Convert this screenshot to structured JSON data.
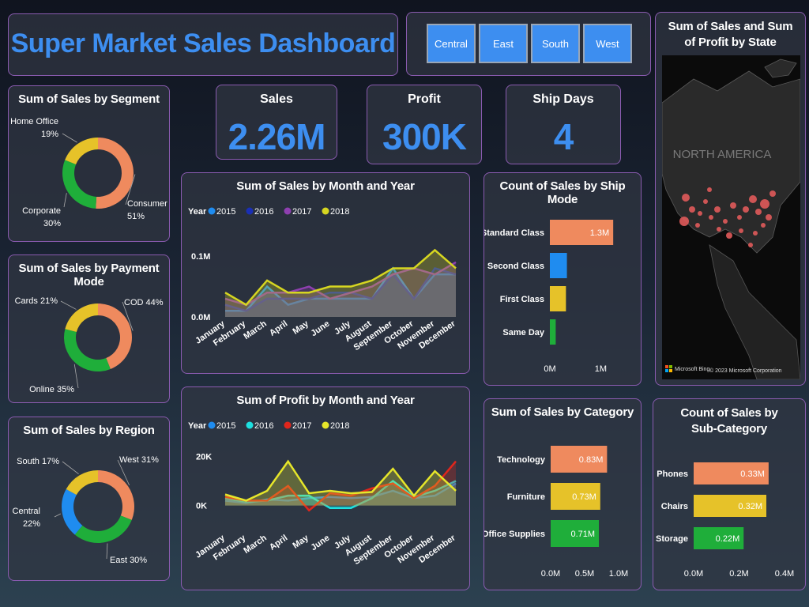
{
  "title": "Super Market Sales Dashboard",
  "slicers": [
    "Central",
    "East",
    "South",
    "West"
  ],
  "kpis": {
    "sales": {
      "label": "Sales",
      "value": "2.26M"
    },
    "profit": {
      "label": "Profit",
      "value": "300K"
    },
    "ship_days": {
      "label": "Ship Days",
      "value": "4"
    }
  },
  "colors": {
    "accent": "#3d8ef0",
    "orange": "#ef8a5e",
    "yellow": "#e6c229",
    "green": "#1fae3a",
    "blue": "#1f8cf0",
    "border": "#8a5bb0"
  },
  "map": {
    "title": "Sum of Sales and Sum of Profit by State",
    "region_label": "NORTH AMERICA",
    "bing_label": "Microsoft Bing",
    "copyright": "© 2023 Microsoft Corporation"
  },
  "chart_data": [
    {
      "id": "segment",
      "type": "pie",
      "title": "Sum of Sales by Segment",
      "slices": [
        {
          "name": "Consumer",
          "value": 51,
          "label": "51%",
          "color": "#ef8a5e"
        },
        {
          "name": "Corporate",
          "value": 30,
          "label": "30%",
          "color": "#1fae3a"
        },
        {
          "name": "Home Office",
          "value": 19,
          "label": "19%",
          "color": "#e6c229"
        }
      ]
    },
    {
      "id": "payment",
      "type": "pie",
      "title": "Sum of Sales by Payment Mode",
      "slices": [
        {
          "name": "COD",
          "value": 44,
          "label": "COD 44%",
          "color": "#ef8a5e"
        },
        {
          "name": "Online",
          "value": 35,
          "label": "Online 35%",
          "color": "#1fae3a"
        },
        {
          "name": "Cards",
          "value": 21,
          "label": "Cards 21%",
          "color": "#e6c229"
        }
      ]
    },
    {
      "id": "region",
      "type": "pie",
      "title": "Sum of Sales by Region",
      "slices": [
        {
          "name": "West",
          "value": 31,
          "label": "West 31%",
          "color": "#ef8a5e"
        },
        {
          "name": "East",
          "value": 30,
          "label": "East 30%",
          "color": "#1fae3a"
        },
        {
          "name": "Central",
          "value": 22,
          "label": "Central 22%",
          "color": "#1f8cf0"
        },
        {
          "name": "South",
          "value": 17,
          "label": "South 17%",
          "color": "#e6c229"
        }
      ]
    },
    {
      "id": "sales_month",
      "type": "area",
      "title": "Sum of Sales by Month and Year",
      "legend_title": "Year",
      "categories": [
        "January",
        "February",
        "March",
        "April",
        "May",
        "June",
        "July",
        "August",
        "September",
        "October",
        "November",
        "December"
      ],
      "yticks": [
        "0.0M",
        "0.1M"
      ],
      "ylim": [
        0,
        0.13
      ],
      "series": [
        {
          "name": "2015",
          "color": "#1f8cf0",
          "values": [
            0.01,
            0.01,
            0.05,
            0.02,
            0.03,
            0.03,
            0.03,
            0.03,
            0.08,
            0.03,
            0.07,
            0.07
          ]
        },
        {
          "name": "2016",
          "color": "#1a2fb5",
          "values": [
            0.02,
            0.01,
            0.03,
            0.03,
            0.03,
            0.04,
            0.04,
            0.03,
            0.07,
            0.03,
            0.08,
            0.07
          ]
        },
        {
          "name": "2017",
          "color": "#8e3fb0",
          "values": [
            0.03,
            0.02,
            0.04,
            0.04,
            0.05,
            0.03,
            0.04,
            0.05,
            0.07,
            0.08,
            0.07,
            0.09
          ]
        },
        {
          "name": "2018",
          "color": "#d6d621",
          "values": [
            0.04,
            0.02,
            0.06,
            0.04,
            0.04,
            0.05,
            0.05,
            0.06,
            0.08,
            0.08,
            0.11,
            0.08
          ]
        }
      ]
    },
    {
      "id": "profit_month",
      "type": "area",
      "title": "Sum of Profit by Month and Year",
      "legend_title": "Year",
      "categories": [
        "January",
        "February",
        "March",
        "April",
        "May",
        "June",
        "July",
        "August",
        "September",
        "October",
        "November",
        "December"
      ],
      "yticks": [
        "0K",
        "20K"
      ],
      "ylim": [
        -4000,
        25000
      ],
      "series": [
        {
          "name": "2015",
          "color": "#1f8cf0",
          "values": [
            2000,
            1000,
            2500,
            2000,
            3000,
            3500,
            3000,
            3500,
            6000,
            3000,
            4000,
            9000
          ]
        },
        {
          "name": "2016",
          "color": "#1de0e0",
          "values": [
            3000,
            1500,
            2000,
            4000,
            4000,
            -1000,
            -1000,
            3000,
            10000,
            3500,
            6000,
            10000
          ]
        },
        {
          "name": "2017",
          "color": "#e0261c",
          "values": [
            3500,
            2000,
            2000,
            8000,
            -2000,
            5000,
            4000,
            7000,
            9000,
            3000,
            8000,
            18000
          ]
        },
        {
          "name": "2018",
          "color": "#e6e62a",
          "values": [
            4500,
            2000,
            6000,
            18000,
            5000,
            6000,
            5000,
            5500,
            15000,
            4000,
            14000,
            6000
          ]
        }
      ]
    },
    {
      "id": "ship_mode",
      "type": "bar",
      "title": "Count of Sales by Ship Mode",
      "categories": [
        "Standard Class",
        "Second Class",
        "First Class",
        "Same Day"
      ],
      "values": [
        1.3,
        0.35,
        0.33,
        0.12
      ],
      "data_labels": [
        "1.3M",
        "",
        "",
        ""
      ],
      "colors": [
        "#ef8a5e",
        "#1f8cf0",
        "#e6c229",
        "#1fae3a"
      ],
      "xticks": [
        "0M",
        "1M"
      ],
      "xlim": [
        0,
        1.8
      ]
    },
    {
      "id": "category",
      "type": "bar",
      "title": "Sum of Sales by Category",
      "categories": [
        "Technology",
        "Furniture",
        "Office Supplies"
      ],
      "values": [
        0.83,
        0.73,
        0.71
      ],
      "data_labels": [
        "0.83M",
        "0.73M",
        "0.71M"
      ],
      "colors": [
        "#ef8a5e",
        "#e6c229",
        "#1fae3a"
      ],
      "xticks": [
        "0.0M",
        "0.5M",
        "1.0M"
      ],
      "xlim": [
        0,
        1.0
      ]
    },
    {
      "id": "subcategory",
      "type": "bar",
      "title": "Count of Sales by Sub-Category",
      "categories": [
        "Phones",
        "Chairs",
        "Storage"
      ],
      "values": [
        0.33,
        0.32,
        0.22
      ],
      "data_labels": [
        "0.33M",
        "0.32M",
        "0.22M"
      ],
      "colors": [
        "#ef8a5e",
        "#e6c229",
        "#1fae3a"
      ],
      "xticks": [
        "0.0M",
        "0.2M",
        "0.4M"
      ],
      "xlim": [
        0,
        0.4
      ]
    }
  ]
}
